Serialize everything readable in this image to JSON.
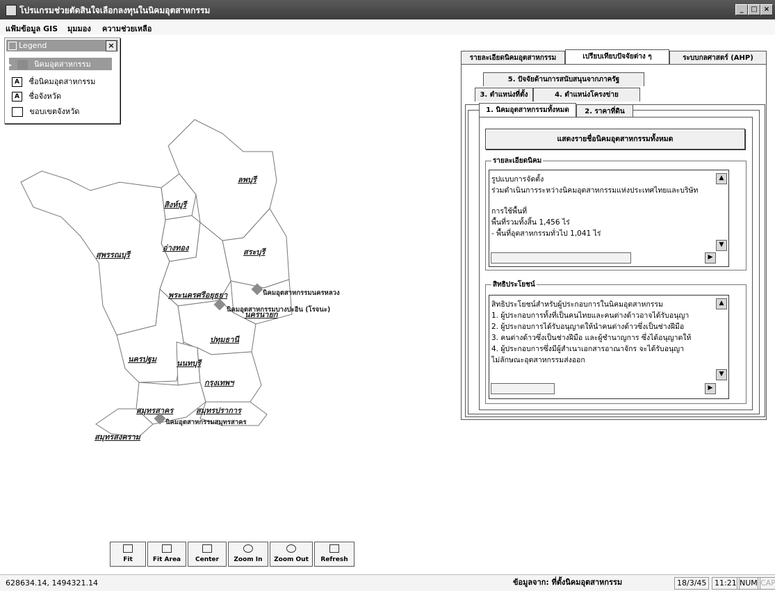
{
  "window": {
    "title": "โปรแกรมช่วยตัดสินใจเลือกลงทุนในนิคมอุตสาหกรรม",
    "controls": [
      "_",
      "□",
      "×"
    ]
  },
  "menu": [
    "แฟ้มข้อมูล GIS",
    "มุมมอง",
    "ความช่วยเหลือ"
  ],
  "legend": {
    "title": "Legend",
    "close": "×",
    "items": [
      {
        "label": "นิคมอุตสาหกรรม",
        "symbol": "point",
        "color": "#8c8c8c"
      },
      {
        "label": "ชื่อนิคมอุตสาหกรรม",
        "symbol": "A"
      },
      {
        "label": "ชื่อจังหวัด",
        "symbol": "A"
      },
      {
        "label": "ขอบเขตจังหวัด",
        "symbol": "box"
      }
    ]
  },
  "map": {
    "provinces": [
      "ลพบุรี",
      "สิงห์บุรี",
      "อ่างทอง",
      "สระบุรี",
      "สุพรรณบุรี",
      "พระนครศรีอยุธยา",
      "นครนายก",
      "ปทุมธานี",
      "นครปฐม",
      "นนทบุรี",
      "กรุงเทพฯ",
      "สมุทรสาคร",
      "สมุทรปราการ",
      "สมุทรสงคราม"
    ],
    "estates": [
      "นิคมอุตสาหกรรมนครหลวง",
      "นิคมอุตสาหกรรมบางปะอิน (โรจนะ)",
      "นิคมอุตสาหกรรมสมุทรสาคร"
    ]
  },
  "panel": {
    "tabs_top": [
      "รายละเอียดนิคมอุตสาหกรรม",
      "เปรียบเทียบปัจจัยต่าง ๆ",
      "ระบบกลศาสตร์ (AHP)"
    ],
    "tabs_mid1": [
      "5. ปัจจัยด้านการสนับสนุนจากภาครัฐ"
    ],
    "tabs_mid2": [
      "3. ตำแหน่งที่ตั้ง",
      "4. ตำแหน่งโครงข่าย"
    ],
    "tabs_mid3": [
      "1. นิคมอุตสาหกรรมทั้งหมด",
      "2. ราคาที่ดิน"
    ],
    "show_all_button": "แสดงรายชื่อนิคมอุตสาหกรรมทั้งหมด",
    "details": {
      "label": "รายละเอียดนิคม",
      "lines": [
        "รูปแบบการจัดตั้ง",
        "ร่วมดำเนินการระหว่างนิคมอุตสาหกรรมแห่งประเทศไทยและบริษัท",
        "",
        "การใช้พื้นที่",
        "พื้นที่รวมทั้งสิ้น 1,456 ไร่",
        "  - พื้นที่อุตสาหกรรมทั่วไป 1,041 ไร่"
      ]
    },
    "privileges": {
      "label": "สิทธิประโยชน์",
      "lines": [
        "สิทธิประโยชน์สำหรับผู้ประกอบการในนิคมอุตสาหกรรม",
        "      1. ผู้ประกอบการทั้งที่เป็นคนไทยและคนต่างด้าวอาจได้รับอนุญา",
        "      2. ผู้ประกอบการได้รับอนุญาตให้นำคนต่างด้าวซึ่งเป็นช่างฝีมือ",
        "      3. คนต่างด้าวซึ่งเป็นช่างฝีมือ และผู้ชำนาญการ ซึ่งได้อนุญาตให้",
        "      4. ผู้ประกอบการซึ่งมีผู้สำเนาเอกสารอาณาจักร จะได้รับอนุญา",
        "              ไม่ลักษณะอุตสาหกรรมส่งออก"
      ]
    }
  },
  "toolbar": {
    "buttons": [
      {
        "label": "Fit",
        "icon": "fit-icon"
      },
      {
        "label": "Fit Area",
        "icon": "fit-area-icon"
      },
      {
        "label": "Center",
        "icon": "center-icon"
      },
      {
        "label": "Zoom In",
        "icon": "zoom-in-icon"
      },
      {
        "label": "Zoom Out",
        "icon": "zoom-out-icon"
      },
      {
        "label": "Refresh",
        "icon": "refresh-icon"
      }
    ]
  },
  "status": {
    "coords": "628634.14, 1494321.14",
    "source": "ข้อมูลจาก: ที่ตั้งนิคมอุตสาหกรรม",
    "date": "18/3/45",
    "time": "11:21",
    "num": "NUM",
    "caps": "CAPS"
  }
}
